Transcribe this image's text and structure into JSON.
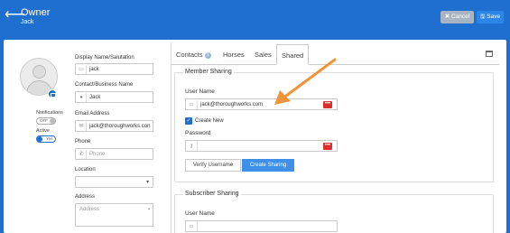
{
  "header": {
    "back_icon": "back-arrow-icon",
    "title": "Owner",
    "subtitle": "Jack",
    "cancel_label": "✖ Cancel",
    "save_label": "🖫 Save"
  },
  "left": {
    "notifications_label": "Notifications",
    "notifications_toggle": "OFF",
    "active_label": "Active",
    "active_toggle": "Yes"
  },
  "form": {
    "display_name_label": "Display Name/Salutation",
    "display_name_value": "jack",
    "contact_name_label": "Contact/Business Name",
    "contact_name_value": "Jack",
    "email_label": "Email Address",
    "email_value": "jack@thoroughworks.con",
    "phone_label": "Phone",
    "phone_placeholder": "Phone",
    "location_label": "Location",
    "location_value": "",
    "address_label": "Address",
    "address_placeholder": "Address"
  },
  "tabs": [
    {
      "label": "Contacts",
      "badge": "1"
    },
    {
      "label": "Horses"
    },
    {
      "label": "Sales"
    },
    {
      "label": "Shared"
    }
  ],
  "member_sharing": {
    "legend": "Member Sharing",
    "username_label": "User Name",
    "username_value": "jack@thoroughworks.com",
    "create_new_label": "Create New",
    "create_new_checked": true,
    "password_label": "Password",
    "password_value": "",
    "verify_button": "Verify Username",
    "create_button": "Create Sharing"
  },
  "subscriber_sharing": {
    "legend": "Subscriber Sharing",
    "username_label": "User Name",
    "username_value": ""
  },
  "colors": {
    "header_blue": "#1f6fd0",
    "annotation_arrow": "#f0943a",
    "dots_red": "#d9302e"
  }
}
